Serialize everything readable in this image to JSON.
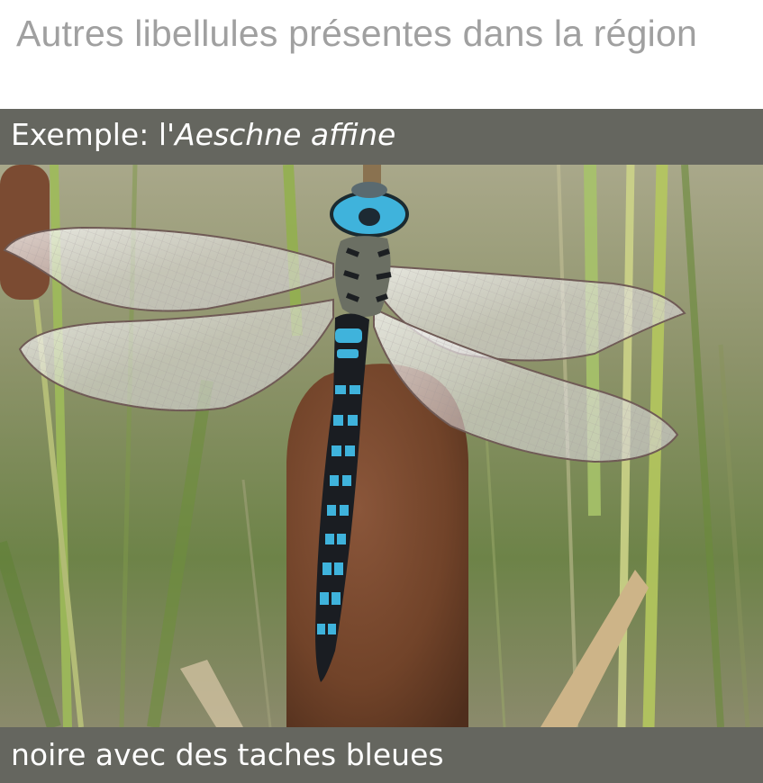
{
  "title": "Autres libellules présentes dans la région",
  "caption_top": {
    "prefix": "Exemple: l'",
    "species": "Aeschne affine"
  },
  "caption_bottom": "noire avec des taches bleues",
  "photo": {
    "subject": "dragonfly-on-cattail",
    "colors": {
      "dragonfly_blue": "#3fb3dc",
      "dragonfly_black": "#1a1d22",
      "cattail_brown": "#7a4a30",
      "grass_green": "#6f8d4a",
      "caption_bar": "#65665f"
    }
  }
}
